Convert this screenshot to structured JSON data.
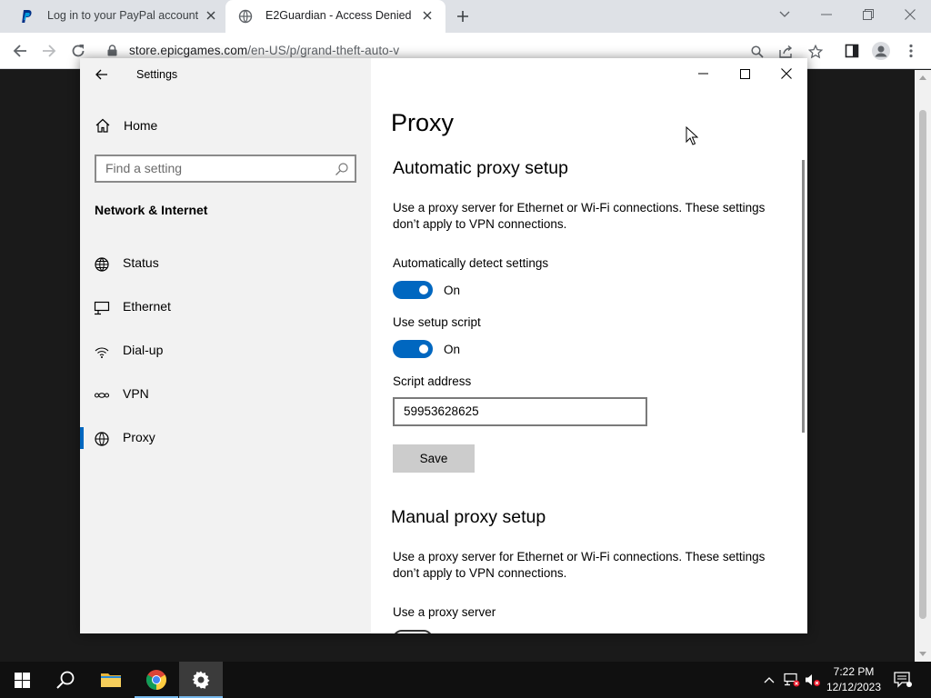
{
  "browser": {
    "tabs": [
      {
        "title": "Log in to your PayPal account",
        "active": false
      },
      {
        "title": "E2Guardian - Access Denied",
        "active": true
      }
    ],
    "url_host": "store.epicgames.com",
    "url_path": "/en-US/p/grand-theft-auto-v"
  },
  "settings": {
    "app_title": "Settings",
    "nav": {
      "home": "Home",
      "search_placeholder": "Find a setting",
      "section": "Network & Internet",
      "items": [
        {
          "label": "Status",
          "icon": "globe-icon"
        },
        {
          "label": "Ethernet",
          "icon": "ethernet-icon"
        },
        {
          "label": "Dial-up",
          "icon": "dial-up-icon"
        },
        {
          "label": "VPN",
          "icon": "vpn-icon"
        },
        {
          "label": "Proxy",
          "icon": "globe-icon",
          "selected": true
        }
      ]
    },
    "content": {
      "page_title": "Proxy",
      "auto": {
        "heading": "Automatic proxy setup",
        "desc": "Use a proxy server for Ethernet or Wi-Fi connections. These settings don’t apply to VPN connections.",
        "detect_label": "Automatically detect settings",
        "detect_state": "On",
        "script_label": "Use setup script",
        "script_state": "On",
        "address_label": "Script address",
        "address_value": "59953628625",
        "save": "Save"
      },
      "manual": {
        "heading": "Manual proxy setup",
        "desc": "Use a proxy server for Ethernet or Wi-Fi connections. These settings don’t apply to VPN connections.",
        "use_proxy_label": "Use a proxy server"
      }
    }
  },
  "taskbar": {
    "time": "7:22 PM",
    "date": "12/12/2023"
  },
  "colors": {
    "accent": "#0067c0",
    "taskbar": "#101010"
  }
}
